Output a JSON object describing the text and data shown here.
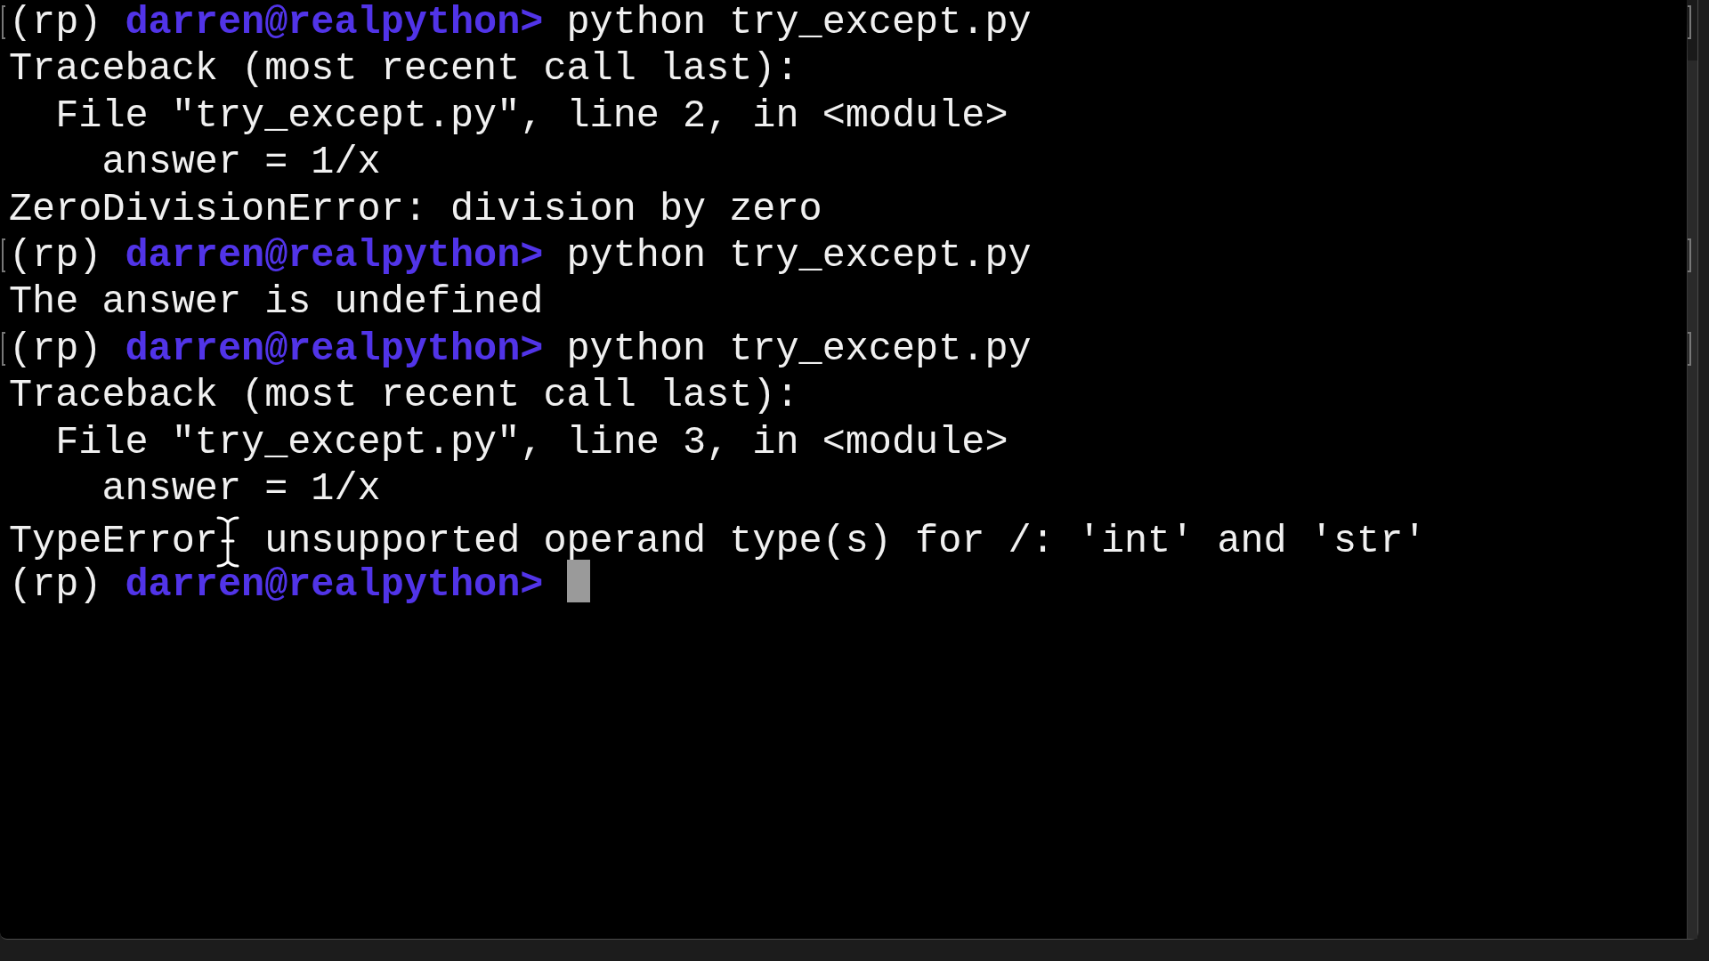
{
  "terminal": {
    "lines": [
      {
        "kind": "prompt",
        "env": "(rp)",
        "user": "darren@realpython>",
        "command": "python try_except.py",
        "marked": true,
        "cursor": false
      },
      {
        "kind": "output",
        "text": "Traceback (most recent call last):"
      },
      {
        "kind": "output",
        "text": "  File \"try_except.py\", line 2, in <module>"
      },
      {
        "kind": "output",
        "text": "    answer = 1/x"
      },
      {
        "kind": "output",
        "text": "ZeroDivisionError: division by zero"
      },
      {
        "kind": "prompt",
        "env": "(rp)",
        "user": "darren@realpython>",
        "command": "python try_except.py",
        "marked": true,
        "cursor": false
      },
      {
        "kind": "output",
        "text": "The answer is undefined"
      },
      {
        "kind": "prompt",
        "env": "(rp)",
        "user": "darren@realpython>",
        "command": "python try_except.py",
        "marked": true,
        "cursor": false
      },
      {
        "kind": "output",
        "text": "Traceback (most recent call last):"
      },
      {
        "kind": "output",
        "text": "  File \"try_except.py\", line 3, in <module>"
      },
      {
        "kind": "output",
        "text": "    answer = 1/x"
      },
      {
        "kind": "pointer_output",
        "before": "TypeError",
        "after": "unsupported operand type(s) for /: 'int' and 'str'"
      },
      {
        "kind": "prompt",
        "env": "(rp)",
        "user": "darren@realpython>",
        "marked": false,
        "cursor": true
      }
    ]
  }
}
